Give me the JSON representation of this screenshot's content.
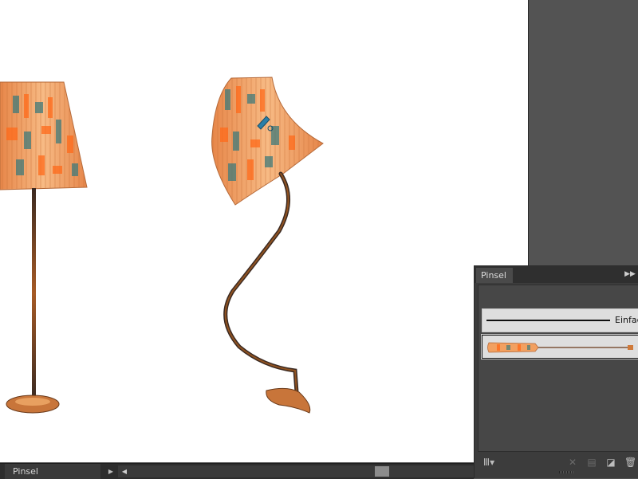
{
  "brushes_panel": {
    "tab_label": "Pinsel",
    "menu_icon": "panel-menu-icon",
    "brushes": [
      {
        "label": "Einfach",
        "type": "basic"
      },
      {
        "label": "",
        "type": "art-brush-lamp"
      }
    ],
    "footer_icons": [
      "brush-libraries-icon",
      "remove-brush-stroke-icon",
      "brush-options-icon",
      "new-brush-icon",
      "delete-brush-icon"
    ]
  },
  "status_bar": {
    "tool_name": "Pinsel"
  },
  "colors": {
    "workspace": "#535353",
    "panel": "#3c3c3c",
    "lampshade": "#f2a060",
    "lamp_stem": "#5a3626",
    "accent_orange": "#ff6a1a"
  }
}
